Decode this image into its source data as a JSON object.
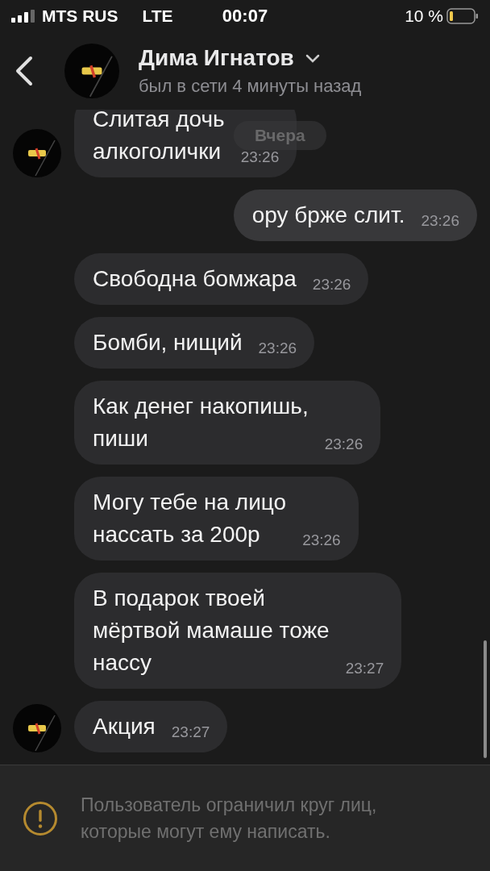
{
  "status_bar": {
    "carrier": "MTS RUS",
    "network": "LTE",
    "time": "00:07",
    "battery": "10 %"
  },
  "header": {
    "name": "Дима Игнатов",
    "status": "был в сети 4 минуты назад"
  },
  "date_chip": "Вчера",
  "messages": [
    {
      "outgoing": false,
      "text": "Слитая дочь\nалкоголички",
      "time": "23:26",
      "avatar": true
    },
    {
      "outgoing": true,
      "text": "ору брже слит.",
      "time": "23:26"
    },
    {
      "outgoing": false,
      "text": "Свободна бомжара",
      "time": "23:26",
      "avatar": false
    },
    {
      "outgoing": false,
      "text": "Бомби, нищий",
      "time": "23:26",
      "avatar": false
    },
    {
      "outgoing": false,
      "text": "Как денег накопишь,\nпиши",
      "time": "23:26",
      "avatar": false
    },
    {
      "outgoing": false,
      "text": "Могу тебе на лицо\nнассать за 200р",
      "time": "23:26",
      "avatar": false
    },
    {
      "outgoing": false,
      "text": "В подарок твоей\nмёртвой мамаше тоже\nнассу",
      "time": "23:27",
      "avatar": false
    },
    {
      "outgoing": false,
      "text": "Акция",
      "time": "23:27",
      "avatar": true
    }
  ],
  "notice": {
    "text": "Пользователь ограничил круг лиц, которые могут ему написать."
  }
}
